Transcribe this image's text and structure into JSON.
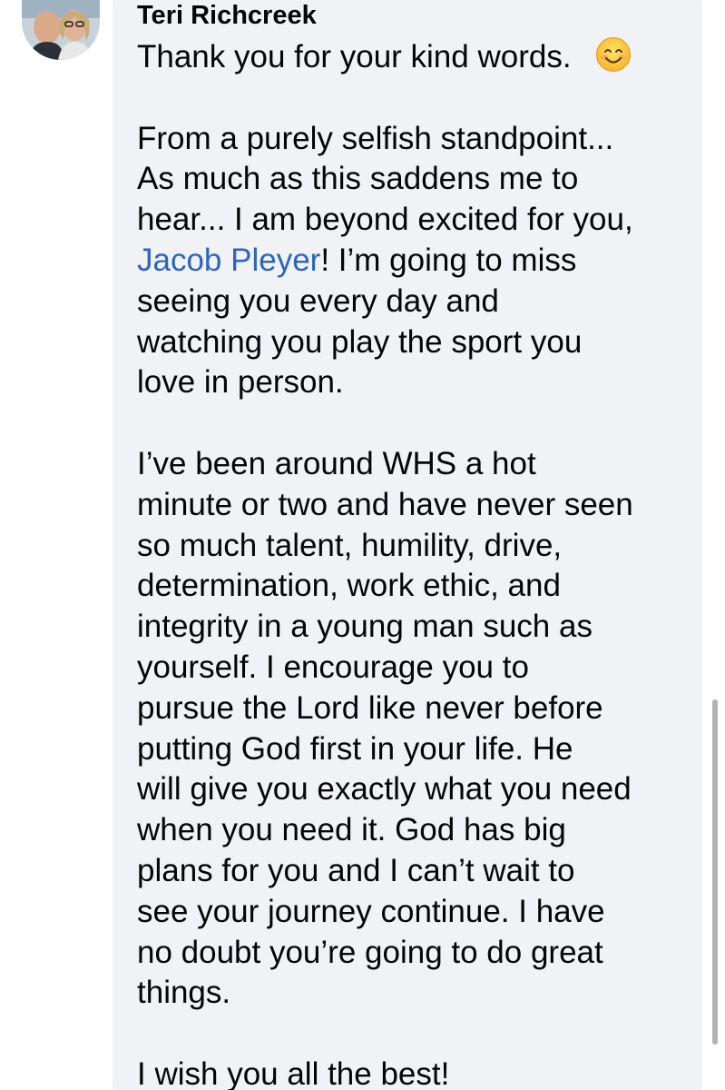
{
  "comment": {
    "author": "Teri Richcreek",
    "line1": "Thank you for your kind words.",
    "emoji": "smiling-face-icon",
    "para2": [
      "From a purely selfish standpoint...",
      "As much as this saddens me to",
      "hear... I am beyond excited for you,"
    ],
    "mention": "Jacob Pleyer",
    "after_mention": "!  I’m going to miss",
    "para2_rest": [
      "seeing you every day and",
      "watching you play the sport you",
      "love in person."
    ],
    "para3": [
      "I’ve been around WHS a hot",
      "minute or two and have never seen",
      "so much talent, humility, drive,",
      "determination, work ethic, and",
      "integrity in a young man such as",
      "yourself.  I encourage you to",
      "pursue the Lord like never before",
      "putting God first in your life.  He",
      "will give you exactly what you need",
      "when you need it.  God has big",
      "plans for you and I can’t wait to",
      "see your journey continue.  I have",
      "no doubt you’re going to do great",
      "things."
    ],
    "closing": "I wish you all the best!"
  },
  "colors": {
    "bubble_bg": "#f0f2f5",
    "text": "#050505",
    "mention": "#2d64bc"
  }
}
